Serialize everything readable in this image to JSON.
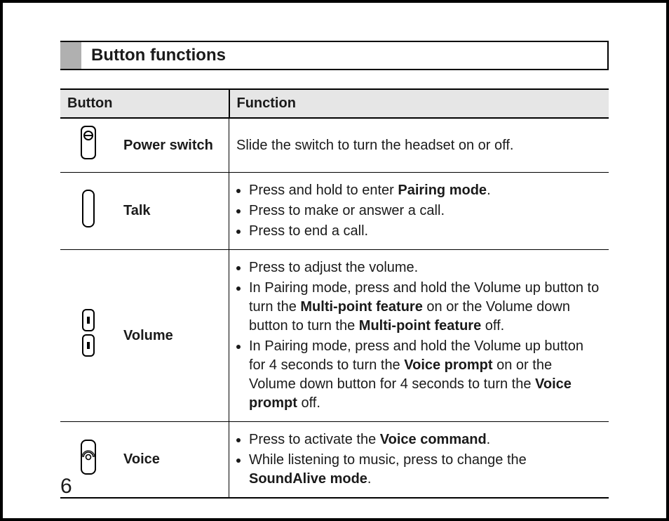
{
  "section_title": "Button functions",
  "table": {
    "header": {
      "button": "Button",
      "function": "Function"
    },
    "rows": [
      {
        "icon": "power-switch-icon",
        "label": "Power switch",
        "desc_plain": "Slide the switch to turn the headset on or off."
      },
      {
        "icon": "talk-button-icon",
        "label": "Talk",
        "bullets": [
          {
            "pre": "Press and hold to enter ",
            "bold1": "Pairing mode",
            "post1": "."
          },
          {
            "pre": "Press to make or answer a call."
          },
          {
            "pre": "Press to end a call."
          }
        ]
      },
      {
        "icon": "volume-button-icon",
        "label": "Volume",
        "bullets": [
          {
            "pre": "Press to adjust the volume."
          },
          {
            "pre": "In Pairing mode, press and hold the Volume up button to turn the ",
            "bold1": "Multi-point feature",
            "post1": " on or the Volume down button to turn the ",
            "bold2": "Multi-point feature",
            "post2": " off."
          },
          {
            "pre": "In Pairing mode, press and hold the Volume up button for 4 seconds to turn the ",
            "bold1": "Voice prompt",
            "post1": " on or the Volume down button for 4 seconds to turn the ",
            "bold2": "Voice prompt",
            "post2": " off."
          }
        ]
      },
      {
        "icon": "voice-button-icon",
        "label": "Voice",
        "bullets": [
          {
            "pre": "Press to activate the ",
            "bold1": "Voice command",
            "post1": "."
          },
          {
            "pre": "While listening to music, press to change the ",
            "bold1": "SoundAlive mode",
            "post1": "."
          }
        ]
      }
    ]
  },
  "page_number": "6"
}
